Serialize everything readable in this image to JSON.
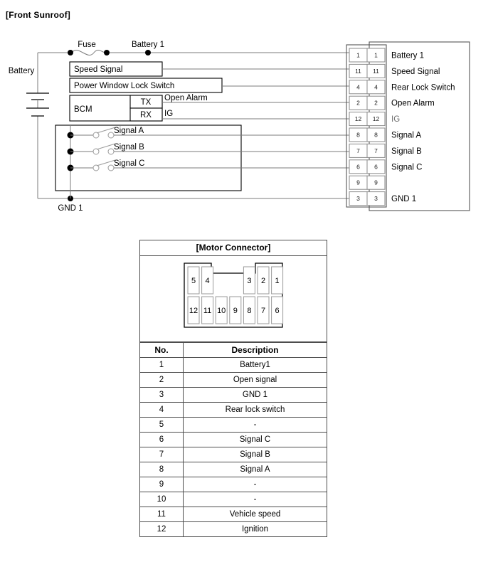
{
  "page": {
    "title": "[Front Sunroof]"
  },
  "circuit": {
    "labels": {
      "battery": "Battery",
      "fuse": "Fuse",
      "battery1": "Battery 1",
      "gnd1": "GND 1",
      "speed_signal": "Speed Signal",
      "power_window_lock_switch": "Power Window Lock Switch",
      "bcm": "BCM",
      "tx": "TX",
      "rx": "RX",
      "open_alarm": "Open Alarm",
      "ig": "IG",
      "signal_a": "Signal A",
      "signal_b": "Signal B",
      "signal_c": "Signal C"
    },
    "connector_rows": [
      {
        "pin_left": "1",
        "pin_right": "1",
        "label": "Battery 1",
        "wired": true,
        "dim": false
      },
      {
        "pin_left": "11",
        "pin_right": "11",
        "label": "Speed Signal",
        "wired": true,
        "dim": false
      },
      {
        "pin_left": "4",
        "pin_right": "4",
        "label": "Rear Lock Switch",
        "wired": true,
        "dim": false
      },
      {
        "pin_left": "2",
        "pin_right": "2",
        "label": "Open Alarm",
        "wired": true,
        "dim": false
      },
      {
        "pin_left": "12",
        "pin_right": "12",
        "label": "IG",
        "wired": true,
        "dim": true
      },
      {
        "pin_left": "8",
        "pin_right": "8",
        "label": "Signal A",
        "wired": true,
        "dim": false
      },
      {
        "pin_left": "7",
        "pin_right": "7",
        "label": "Signal B",
        "wired": true,
        "dim": false
      },
      {
        "pin_left": "6",
        "pin_right": "6",
        "label": "Signal C",
        "wired": true,
        "dim": false
      },
      {
        "pin_left": "9",
        "pin_right": "9",
        "label": "",
        "wired": false,
        "dim": false
      },
      {
        "pin_left": "3",
        "pin_right": "3",
        "label": "GND 1",
        "wired": true,
        "dim": false
      }
    ]
  },
  "motor_connector": {
    "header": "[Motor Connector]",
    "pinout_top_row": [
      "5",
      "4",
      "3",
      "2",
      "1"
    ],
    "pinout_bottom_row": [
      "12",
      "11",
      "10",
      "9",
      "8",
      "7",
      "6"
    ],
    "table": {
      "columns": [
        "No.",
        "Description"
      ],
      "rows": [
        {
          "no": "1",
          "description": "Battery1"
        },
        {
          "no": "2",
          "description": "Open signal"
        },
        {
          "no": "3",
          "description": "GND 1"
        },
        {
          "no": "4",
          "description": "Rear lock switch"
        },
        {
          "no": "5",
          "description": "-"
        },
        {
          "no": "6",
          "description": "Signal C"
        },
        {
          "no": "7",
          "description": "Signal B"
        },
        {
          "no": "8",
          "description": "Signal A"
        },
        {
          "no": "9",
          "description": "-"
        },
        {
          "no": "10",
          "description": "-"
        },
        {
          "no": "11",
          "description": "Vehicle speed"
        },
        {
          "no": "12",
          "description": "Ignition"
        }
      ]
    }
  },
  "colors": {
    "ink": "#000000",
    "wire": "#7b7b7b",
    "frame": "#555555",
    "dim_text": "#6f6f6f"
  }
}
